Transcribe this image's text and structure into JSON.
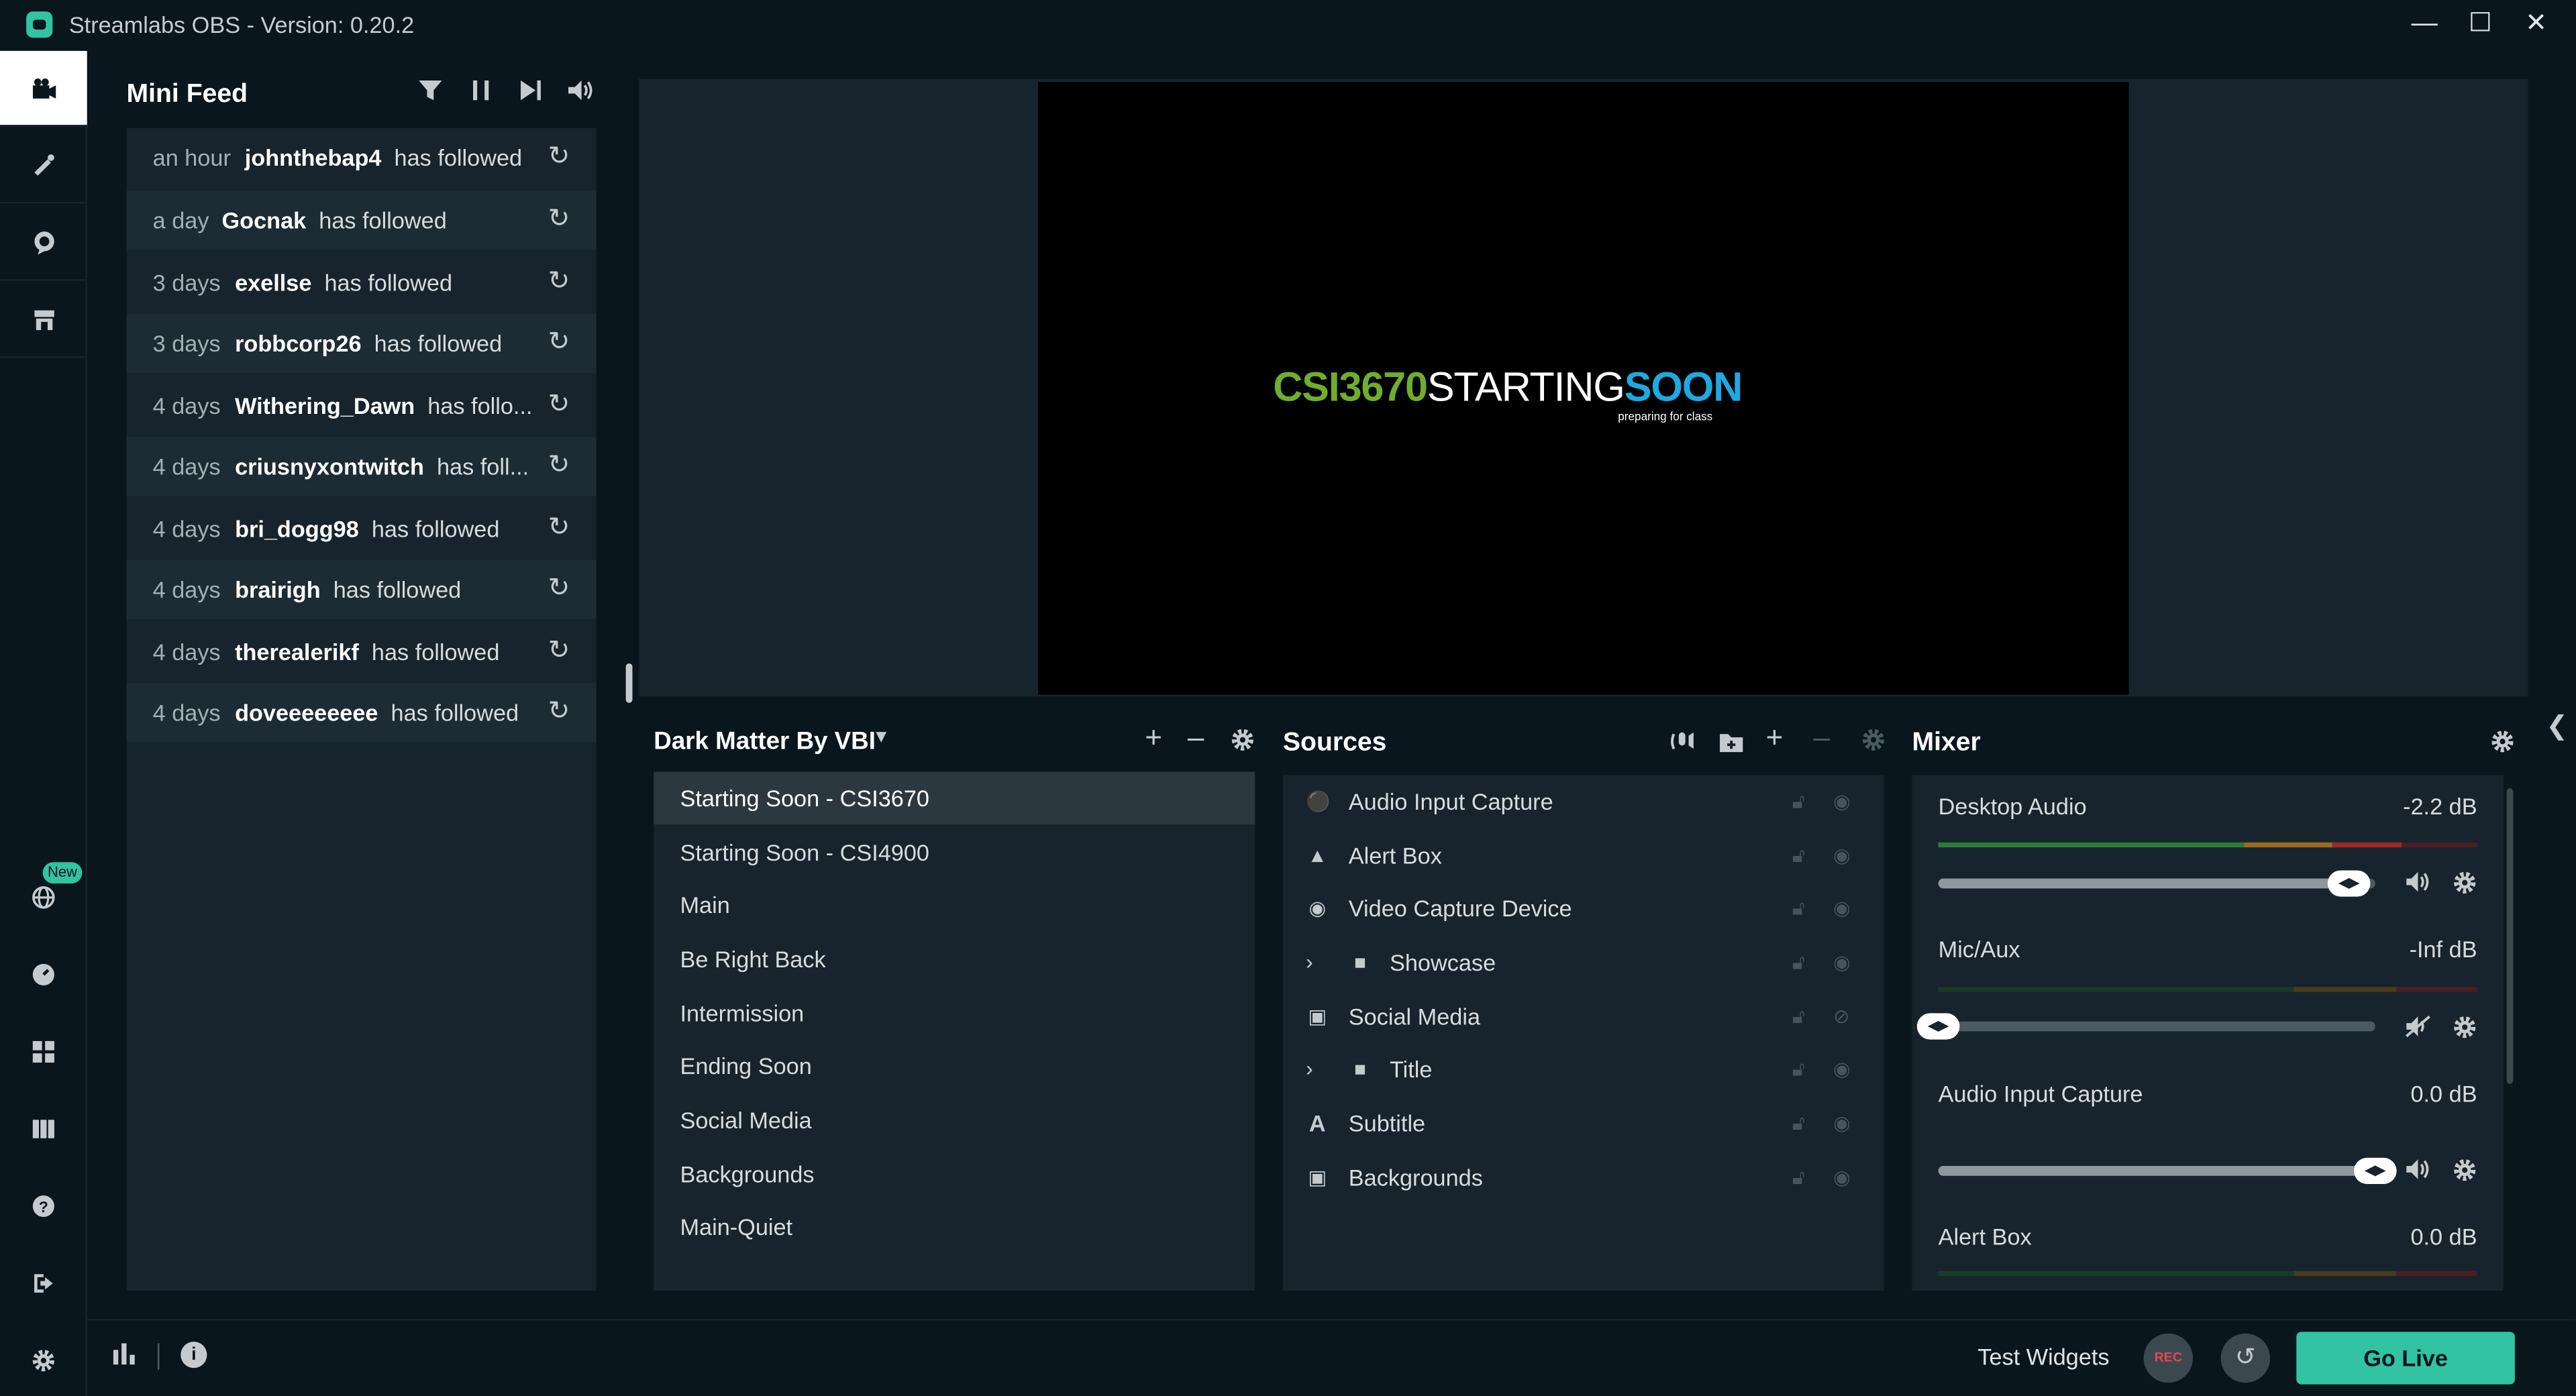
{
  "window": {
    "title": "Streamlabs OBS - Version: 0.20.2",
    "minimize_icon": "minimize-icon",
    "maximize_icon": "maximize-icon",
    "close_icon": "close-icon"
  },
  "nav": {
    "top_items": [
      "editor-icon",
      "themes-icon",
      "chatbot-icon",
      "store-icon"
    ],
    "bottom_items": [
      "globe-icon",
      "dashboard-icon",
      "layout-icon",
      "studio-mode-icon",
      "help-icon",
      "logout-icon",
      "settings-icon"
    ],
    "new_badge": "New"
  },
  "mini_feed": {
    "title": "Mini Feed",
    "items": [
      {
        "time": "an hour",
        "name": "johnthebap4",
        "action": "has followed"
      },
      {
        "time": "a day",
        "name": "Gocnak",
        "action": "has followed"
      },
      {
        "time": "3 days",
        "name": "exellse",
        "action": "has followed"
      },
      {
        "time": "3 days",
        "name": "robbcorp26",
        "action": "has followed"
      },
      {
        "time": "4 days",
        "name": "Withering_Dawn",
        "action": "has follo..."
      },
      {
        "time": "4 days",
        "name": "criusnyxontwitch",
        "action": "has foll..."
      },
      {
        "time": "4 days",
        "name": "bri_dogg98",
        "action": "has followed"
      },
      {
        "time": "4 days",
        "name": "brairigh",
        "action": "has followed"
      },
      {
        "time": "4 days",
        "name": "therealerikf",
        "action": "has followed"
      },
      {
        "time": "4 days",
        "name": "doveeeeeeee",
        "action": "has followed"
      }
    ]
  },
  "preview": {
    "part1": "CSI3670",
    "part2": "STARTING",
    "part3": "SOON",
    "subtitle": "preparing for class",
    "colors": {
      "green": "#6fae2d",
      "blue": "#1ea9e0"
    }
  },
  "scenes": {
    "collection": "Dark Matter By VBI",
    "selected_index": 0,
    "items": [
      "Starting Soon - CSI3670",
      "Starting Soon - CSI4900",
      "Main",
      "Be Right Back",
      "Intermission",
      "Ending Soon",
      "Social Media",
      "Backgrounds",
      "Main-Quiet"
    ]
  },
  "sources": {
    "title": "Sources",
    "items": [
      {
        "icon": "microphone-icon",
        "label": "Audio Input Capture",
        "folder": false
      },
      {
        "icon": "bell-icon",
        "label": "Alert Box",
        "folder": false
      },
      {
        "icon": "webcam-icon",
        "label": "Video Capture Device",
        "folder": false
      },
      {
        "icon": "folder-icon",
        "label": "Showcase",
        "folder": true
      },
      {
        "icon": "image-icon",
        "label": "Social Media",
        "folder": false
      },
      {
        "icon": "folder-icon",
        "label": "Title",
        "folder": true
      },
      {
        "icon": "text-icon",
        "label": "Subtitle",
        "folder": false
      },
      {
        "icon": "image-icon",
        "label": "Backgrounds",
        "folder": false
      }
    ]
  },
  "mixer": {
    "title": "Mixer",
    "channels": [
      {
        "name": "Desktop Audio",
        "db": "-2.2 dB",
        "level": 0.94,
        "meter": 0.86,
        "muted": false
      },
      {
        "name": "Mic/Aux",
        "db": "-Inf dB",
        "level": 0.0,
        "meter": 0.0,
        "muted": true
      },
      {
        "name": "Audio Input Capture",
        "db": "0.0 dB",
        "level": 1.0,
        "meter": 0.0,
        "muted": false
      },
      {
        "name": "Alert Box",
        "db": "0.0 dB",
        "level": 1.0,
        "meter": 0.0,
        "muted": false
      }
    ]
  },
  "footer": {
    "test_widgets": "Test Widgets",
    "rec_label": "REC",
    "go_live": "Go Live"
  }
}
